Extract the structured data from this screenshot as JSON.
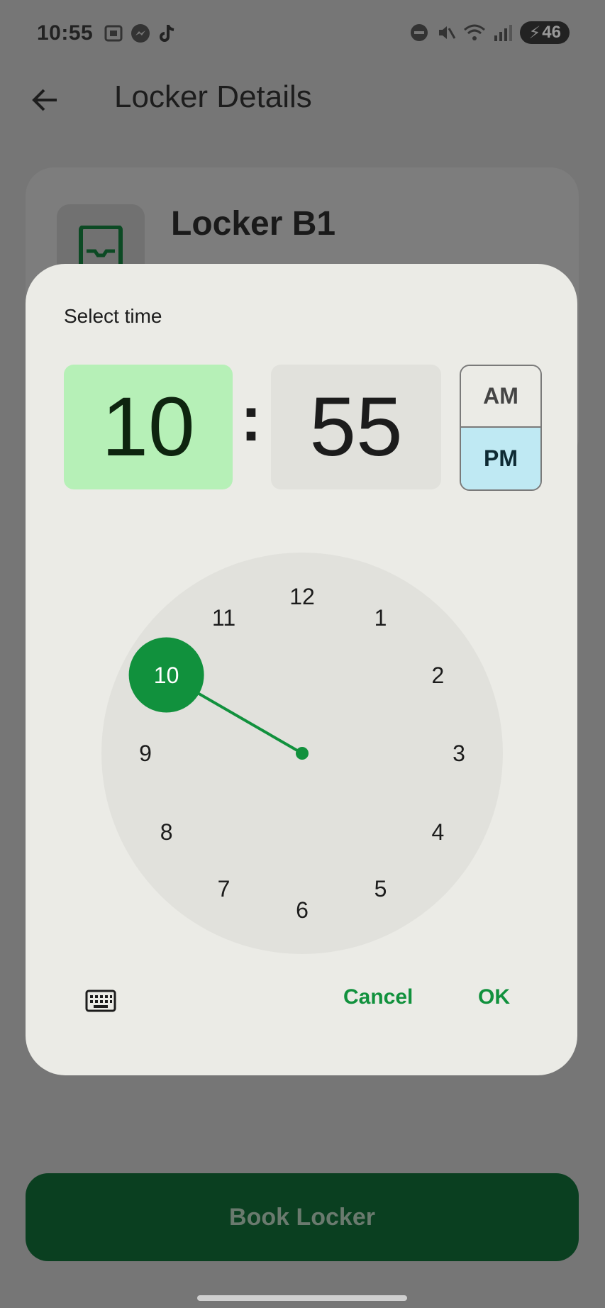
{
  "status_bar": {
    "time": "10:55",
    "battery": "46",
    "left_icons": [
      "screenshot-icon",
      "messenger-icon",
      "tiktok-icon"
    ],
    "right_icons": [
      "dnd-icon",
      "mute-icon",
      "wifi-icon",
      "signal-icon",
      "battery-charging-icon"
    ]
  },
  "app_bar": {
    "title": "Locker Details",
    "back_icon": "arrow-left-icon"
  },
  "card": {
    "locker_name": "Locker B1",
    "icon": "locker-icon"
  },
  "book_button": {
    "label": "Book Locker"
  },
  "time_picker": {
    "title": "Select time",
    "hour": "10",
    "separator": ":",
    "minute": "55",
    "am_label": "AM",
    "pm_label": "PM",
    "period_selected": "PM",
    "dial_numbers": [
      "12",
      "1",
      "2",
      "3",
      "4",
      "5",
      "6",
      "7",
      "8",
      "9",
      "10",
      "11"
    ],
    "selected_hour": 10,
    "keyboard_icon": "keyboard-icon",
    "cancel_label": "Cancel",
    "ok_label": "OK"
  },
  "colors": {
    "accent": "#11913d",
    "hour_bg": "#b6f0b7",
    "pm_bg": "#bfe9f3",
    "book_button_bg": "#0a3f20"
  }
}
